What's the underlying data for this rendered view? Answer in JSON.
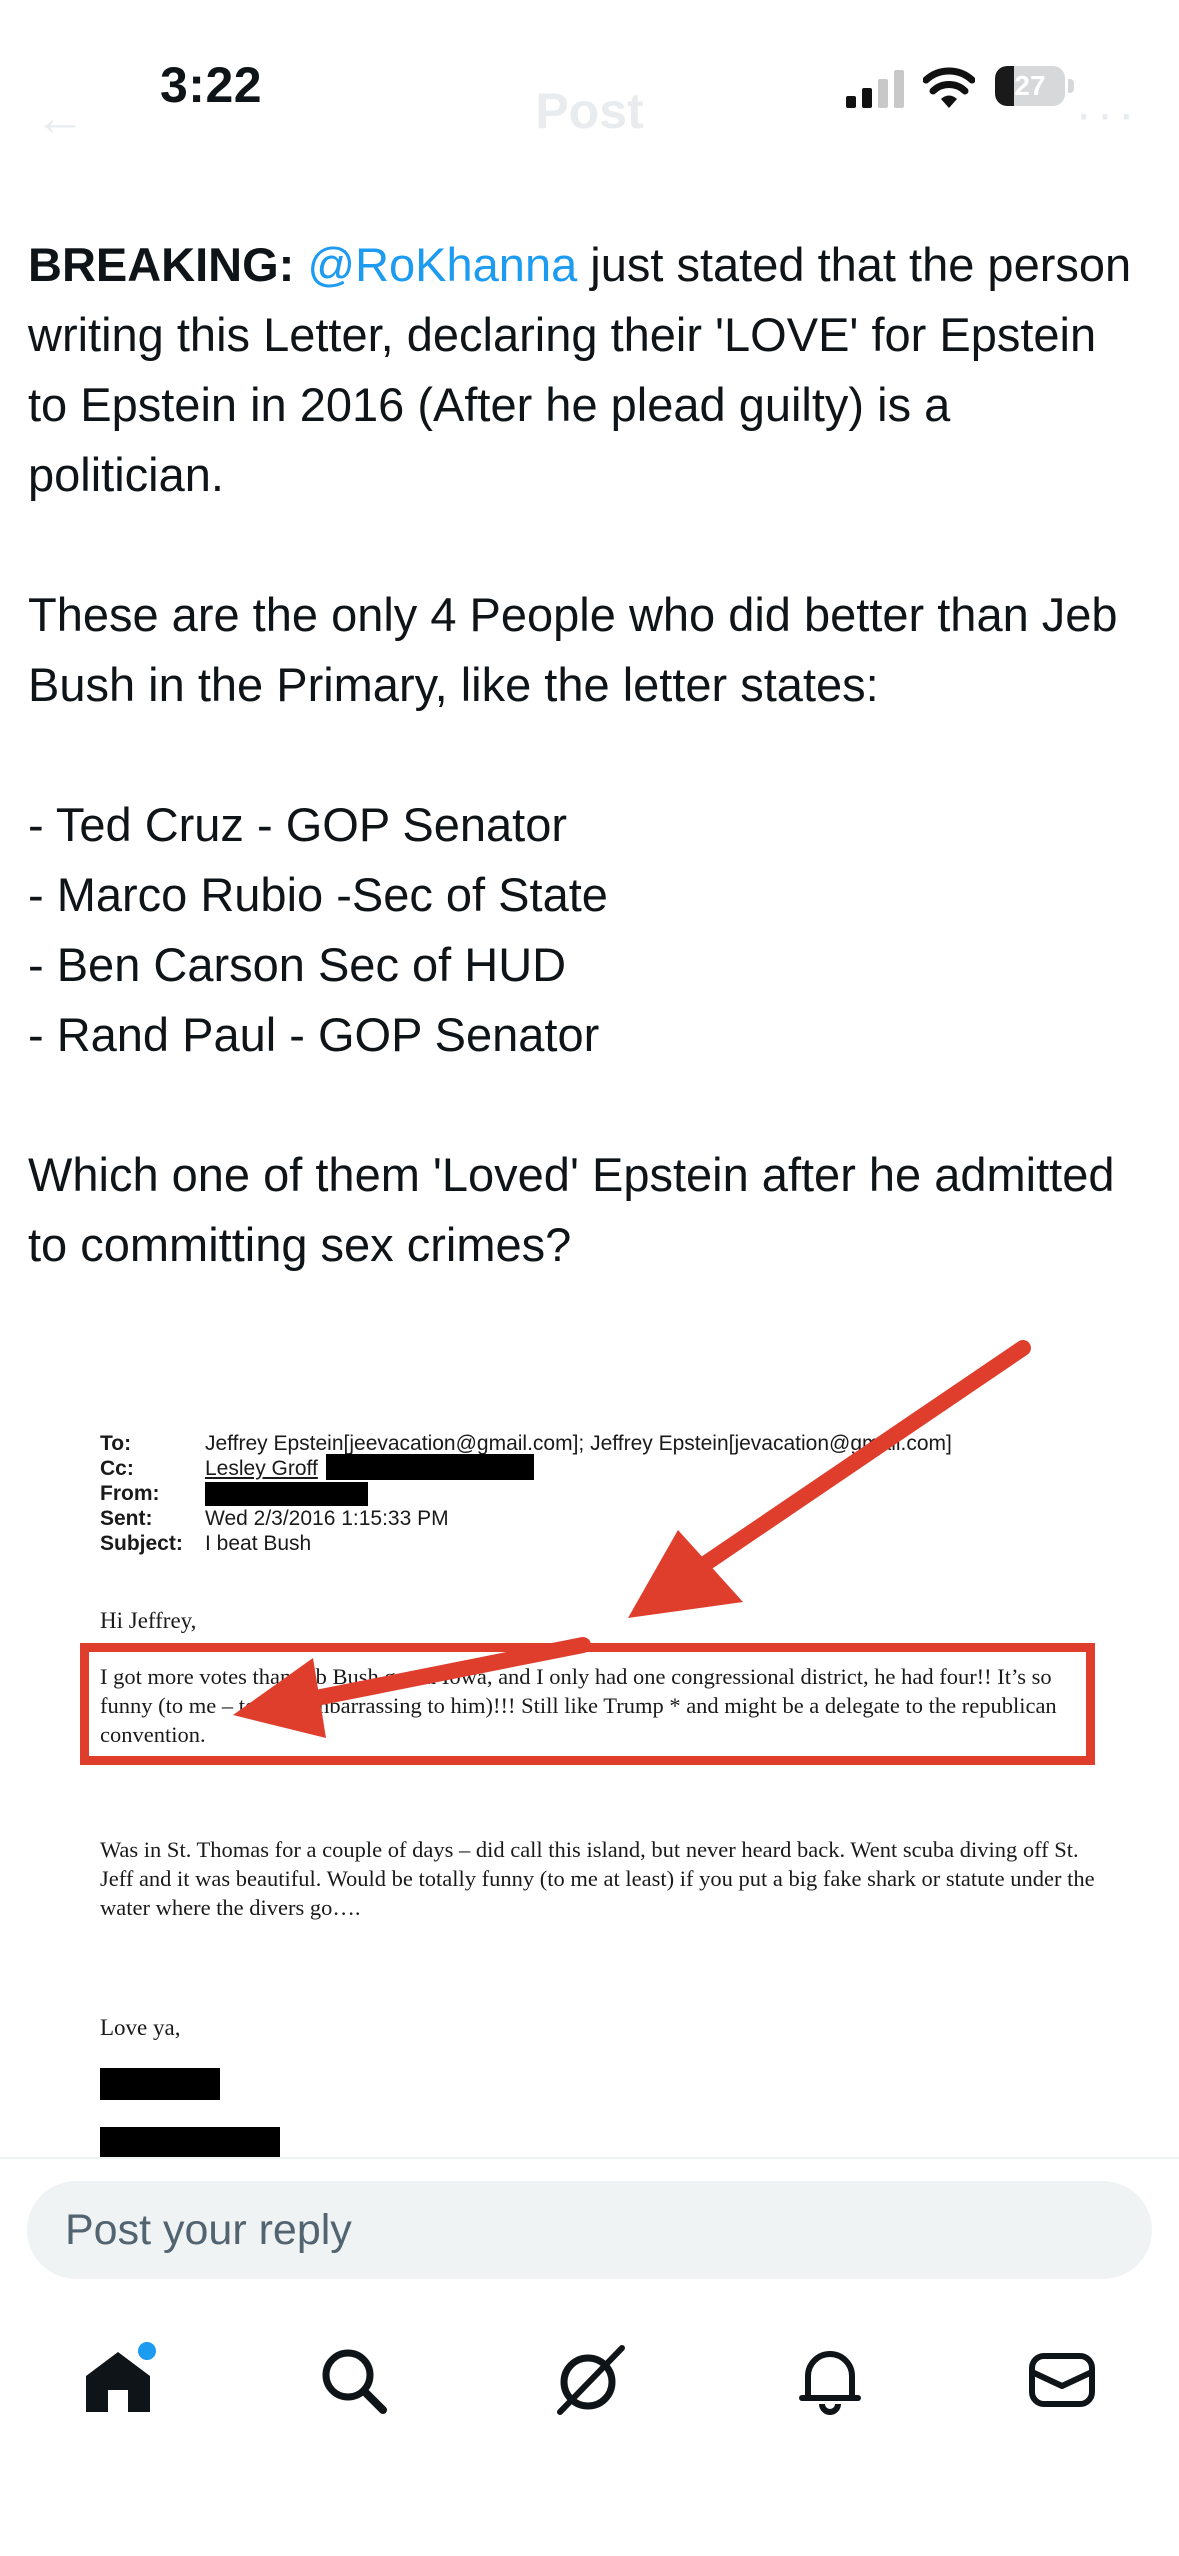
{
  "status_bar": {
    "time": "3:22",
    "battery_level": "27",
    "battery_fraction": 0.27
  },
  "header": {
    "back_icon": "back-arrow-icon",
    "title": "Post",
    "more_icon": "more-icon"
  },
  "tweet": {
    "lead": "BREAKING:",
    "mention": "@RoKhanna",
    "para1_rest": " just stated that the person writing this Letter, declaring their 'LOVE' for Epstein to Epstein in 2016 (After he plead guilty) is a politician.",
    "para2": "These are the only 4 People who did better than Jeb Bush in the Primary, like the letter states:",
    "list": [
      "- Ted Cruz - GOP Senator",
      "- Marco Rubio  -Sec of State",
      "- Ben Carson Sec of HUD",
      "- Rand Paul - GOP Senator"
    ],
    "para3": "Which one of them 'Loved' Epstein after he admitted to committing sex crimes?"
  },
  "email_image": {
    "labels": {
      "to": "To:",
      "cc": "Cc:",
      "from": "From:",
      "sent": "Sent:",
      "subject": "Subject:"
    },
    "to_value": "Jeffrey Epstein[jeevacation@gmail.com]; Jeffrey Epstein[jevacation@gmail.com]",
    "cc_value": "Lesley Groff",
    "sent_value": "Wed 2/3/2016 1:15:33 PM",
    "subject_value": "I beat Bush",
    "greeting": "Hi Jeffrey,",
    "highlighted_paragraph": "I got more votes than Jeb Bush got in Iowa, and I only had one congressional district, he had four!!  It’s so funny (to me – totally embarrassing to him)!!!  Still like Trump *  and might be a delegate to the republican convention.",
    "second_paragraph": "Was in St. Thomas for a couple of days – did call this island, but never heard back.  Went scuba diving off St. Jeff and it was beautiful.  Would be totally funny (to me at least) if you put a big fake shark or statute under the water where the divers go….",
    "signoff": "Love ya,",
    "annotation_color": "#e03e2d"
  },
  "reply": {
    "placeholder": "Post your reply"
  },
  "tab_bar": {
    "items": [
      {
        "name": "home",
        "icon": "home-icon",
        "has_badge": true
      },
      {
        "name": "search",
        "icon": "search-icon"
      },
      {
        "name": "grok",
        "icon": "grok-icon"
      },
      {
        "name": "notifications",
        "icon": "bell-icon"
      },
      {
        "name": "messages",
        "icon": "mail-icon"
      }
    ]
  },
  "colors": {
    "accent": "#1d9bf0",
    "text": "#0f1419",
    "input_bg": "#eff3f4",
    "placeholder": "#536471"
  }
}
